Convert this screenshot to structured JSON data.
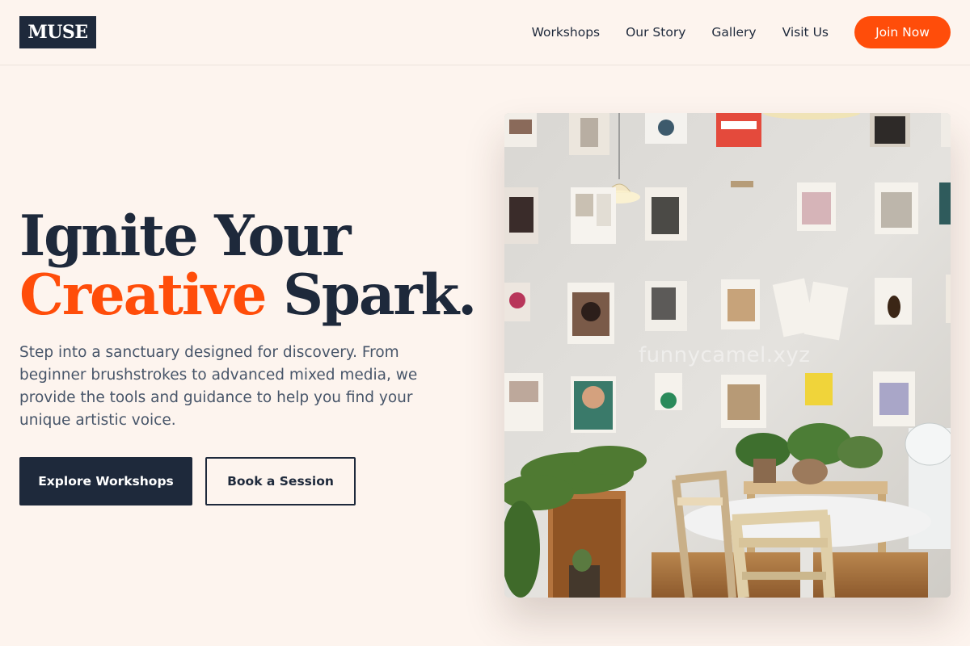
{
  "brand": {
    "logo_text": "MUSE"
  },
  "nav": {
    "links": [
      "Workshops",
      "Our Story",
      "Gallery",
      "Visit Us"
    ],
    "cta_label": "Join Now"
  },
  "hero": {
    "title_line1": "Ignite Your",
    "title_accent": "Creative",
    "title_rest": " Spark.",
    "description": "Step into a sanctuary designed for discovery. From beginner brushstrokes to advanced mixed media, we provide the tools and guidance to help you find your unique artistic voice.",
    "primary_button": "Explore Workshops",
    "secondary_button": "Book a Session",
    "image_watermark": "funnycamel.xyz"
  },
  "colors": {
    "background": "#fdf4ee",
    "navy": "#1e293b",
    "accent": "#ff4d0a",
    "body_text": "#475569"
  }
}
